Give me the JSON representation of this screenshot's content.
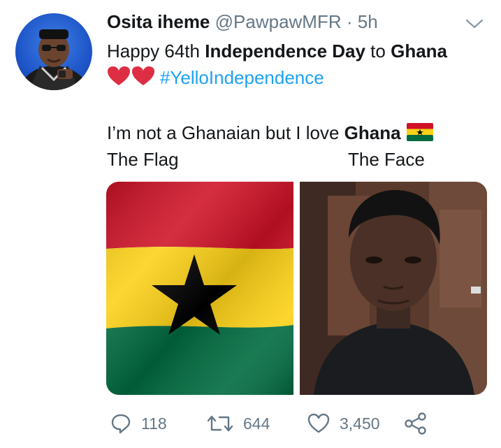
{
  "tweet": {
    "author_name": "Osita iheme",
    "handle": "@PawpawMFR",
    "separator": "·",
    "time": "5h",
    "line1_prefix": "Happy 64th ",
    "line1_bold1": "Independence Day",
    "line1_mid": " to ",
    "line1_bold2": "Ghana",
    "hashtag": "#YelloIndependence",
    "line3_prefix": "I’m not a Ghanaian but I love ",
    "line3_bold": "Ghana",
    "caption_left": "The Flag",
    "caption_right": "The Face"
  },
  "icons": {
    "avatar": "avatar",
    "more": "chevron-down-icon",
    "hearts": "red-heart-emoji",
    "flag": "ghana-flag-emoji",
    "reply": "reply-icon",
    "retweet": "retweet-icon",
    "like": "like-icon",
    "share": "share-icon"
  },
  "actions": {
    "reply_count": "118",
    "retweet_count": "644",
    "like_count": "3,450"
  },
  "colors": {
    "hashtag": "#1da1f2",
    "secondary_text": "#657786",
    "heart": "#dd2e44",
    "flag_red": "#ce1126",
    "flag_yellow": "#fcd116",
    "flag_green": "#006b3f"
  }
}
